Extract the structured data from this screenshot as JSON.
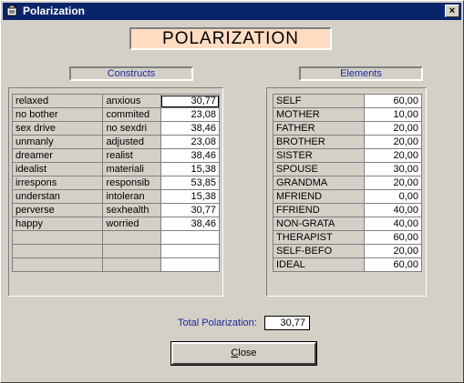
{
  "window": {
    "title": "Polarization",
    "close_glyph": "×"
  },
  "banner": "POLARIZATION",
  "constructs": {
    "label": "Constructs",
    "rows": [
      [
        "relaxed",
        "anxious",
        "30,77"
      ],
      [
        "no bother",
        "commited",
        "23,08"
      ],
      [
        "sex drive",
        "no sexdri",
        "38,46"
      ],
      [
        "unmanly",
        "adjusted",
        "23,08"
      ],
      [
        "dreamer",
        "realist",
        "38,46"
      ],
      [
        "idealist",
        "materiali",
        "15,38"
      ],
      [
        "irrespons",
        "responsib",
        "53,85"
      ],
      [
        "understan",
        "intoleran",
        "15,38"
      ],
      [
        "perverse",
        "sexhealth",
        "30,77"
      ],
      [
        "happy",
        "worried",
        "38,46"
      ],
      [
        "",
        "",
        ""
      ],
      [
        "",
        "",
        ""
      ],
      [
        "",
        "",
        ""
      ]
    ]
  },
  "elements": {
    "label": "Elements",
    "rows": [
      [
        "SELF",
        "60,00"
      ],
      [
        "MOTHER",
        "10,00"
      ],
      [
        "FATHER",
        "20,00"
      ],
      [
        "BROTHER",
        "20,00"
      ],
      [
        "SISTER",
        "20,00"
      ],
      [
        "SPOUSE",
        "30,00"
      ],
      [
        "GRANDMA",
        "20,00"
      ],
      [
        "MFRIEND",
        "0,00"
      ],
      [
        "FFRIEND",
        "40,00"
      ],
      [
        "NON-GRATA",
        "40,00"
      ],
      [
        "THERAPIST",
        "60,00"
      ],
      [
        "SELF-BEFO",
        "20,00"
      ],
      [
        "IDEAL",
        "60,00"
      ]
    ]
  },
  "total": {
    "label": "Total Polarization:",
    "value": "30,77"
  },
  "close_button": {
    "label_underlined": "C",
    "label_rest": "lose"
  },
  "icons": {
    "app": "app-icon",
    "close": "close-icon"
  }
}
